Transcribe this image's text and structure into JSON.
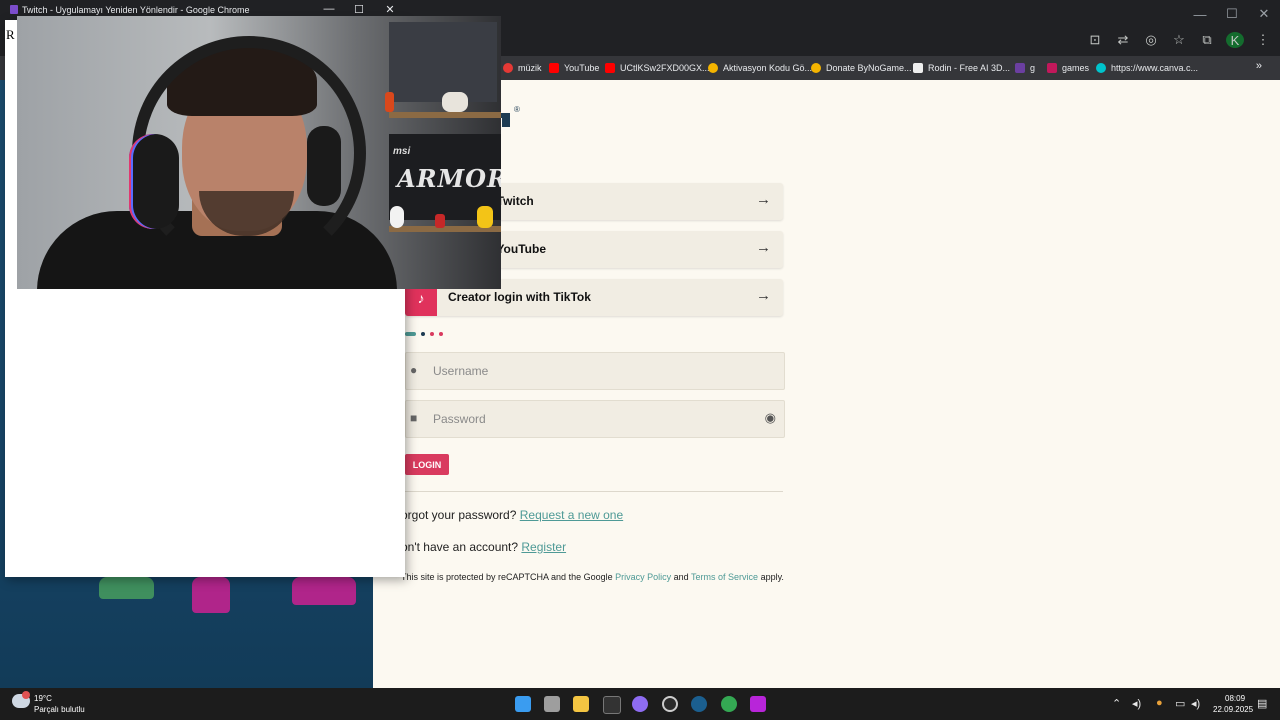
{
  "popup": {
    "title": "Twitch - Uygulamayı Yeniden Yönlendir - Google Chrome",
    "body_char": "R",
    "minimize": "—",
    "maximize": "☐",
    "close": "✕"
  },
  "browser": {
    "window_controls": [
      "—",
      "☐",
      "✕"
    ],
    "profile_initial": "K",
    "bookmarks_overflow": "»",
    "bookmarks": [
      {
        "label": "müzik",
        "color": "#e53935"
      },
      {
        "label": "YouTube",
        "color": "#ff0000"
      },
      {
        "label": "UCtlKSw2FXD00GX...",
        "color": "#ff0000"
      },
      {
        "label": "Aktivasyon Kodu Gö...",
        "color": "#f4b400"
      },
      {
        "label": "Donate ByNoGame...",
        "color": "#f4b400"
      },
      {
        "label": "Rodin - Free AI 3D...",
        "color": "#111111"
      },
      {
        "label": "g",
        "color": "#6b3fa0"
      },
      {
        "label": "games",
        "color": "#c2185b"
      },
      {
        "label": "https://www.canva.c...",
        "color": "#00c4cc"
      }
    ]
  },
  "login": {
    "twitch_label": "gin with Twitch",
    "youtube_label": "gin with YouTube",
    "tiktok_label": "Creator login with TikTok",
    "tiktok_icon": "♪",
    "arrow": "→",
    "username_placeholder": "Username",
    "password_placeholder": "Password",
    "submit_label": "LOGIN",
    "forgot_text": "orgot your password?",
    "forgot_link": "Request a new one",
    "register_text": "on't have an account?",
    "register_link": "Register",
    "recaptcha_prefix": "This site is protected by reCAPTCHA and the Google",
    "privacy_link": "Privacy Policy",
    "and_text": "and",
    "terms_link": "Terms of Service",
    "apply_text": "apply.",
    "logo_mark": "®",
    "dot_colors": [
      "#4e9a96",
      "#1d3b52",
      "#d93b5f",
      "#d93b5f"
    ]
  },
  "webcam": {
    "armor_text": "ARMOR",
    "msi_text": "msi"
  },
  "taskbar": {
    "temperature": "19°C",
    "weather": "Parçalı bulutlu",
    "time": "08:09",
    "date": "22.09.2025",
    "apps": [
      {
        "name": "windows-start",
        "color": "#3a9cf0"
      },
      {
        "name": "task-view",
        "color": "#9e9e9e"
      },
      {
        "name": "file-explorer",
        "color": "#f4c542"
      },
      {
        "name": "epic-games",
        "color": "#333333"
      },
      {
        "name": "copilot",
        "color": "#8e6cf2"
      },
      {
        "name": "recorder",
        "color": "#cccccc"
      },
      {
        "name": "steam",
        "color": "#1b5f8f"
      },
      {
        "name": "chrome",
        "color": "#34a853"
      },
      {
        "name": "twitch-app",
        "color": "#b825d9"
      }
    ]
  }
}
